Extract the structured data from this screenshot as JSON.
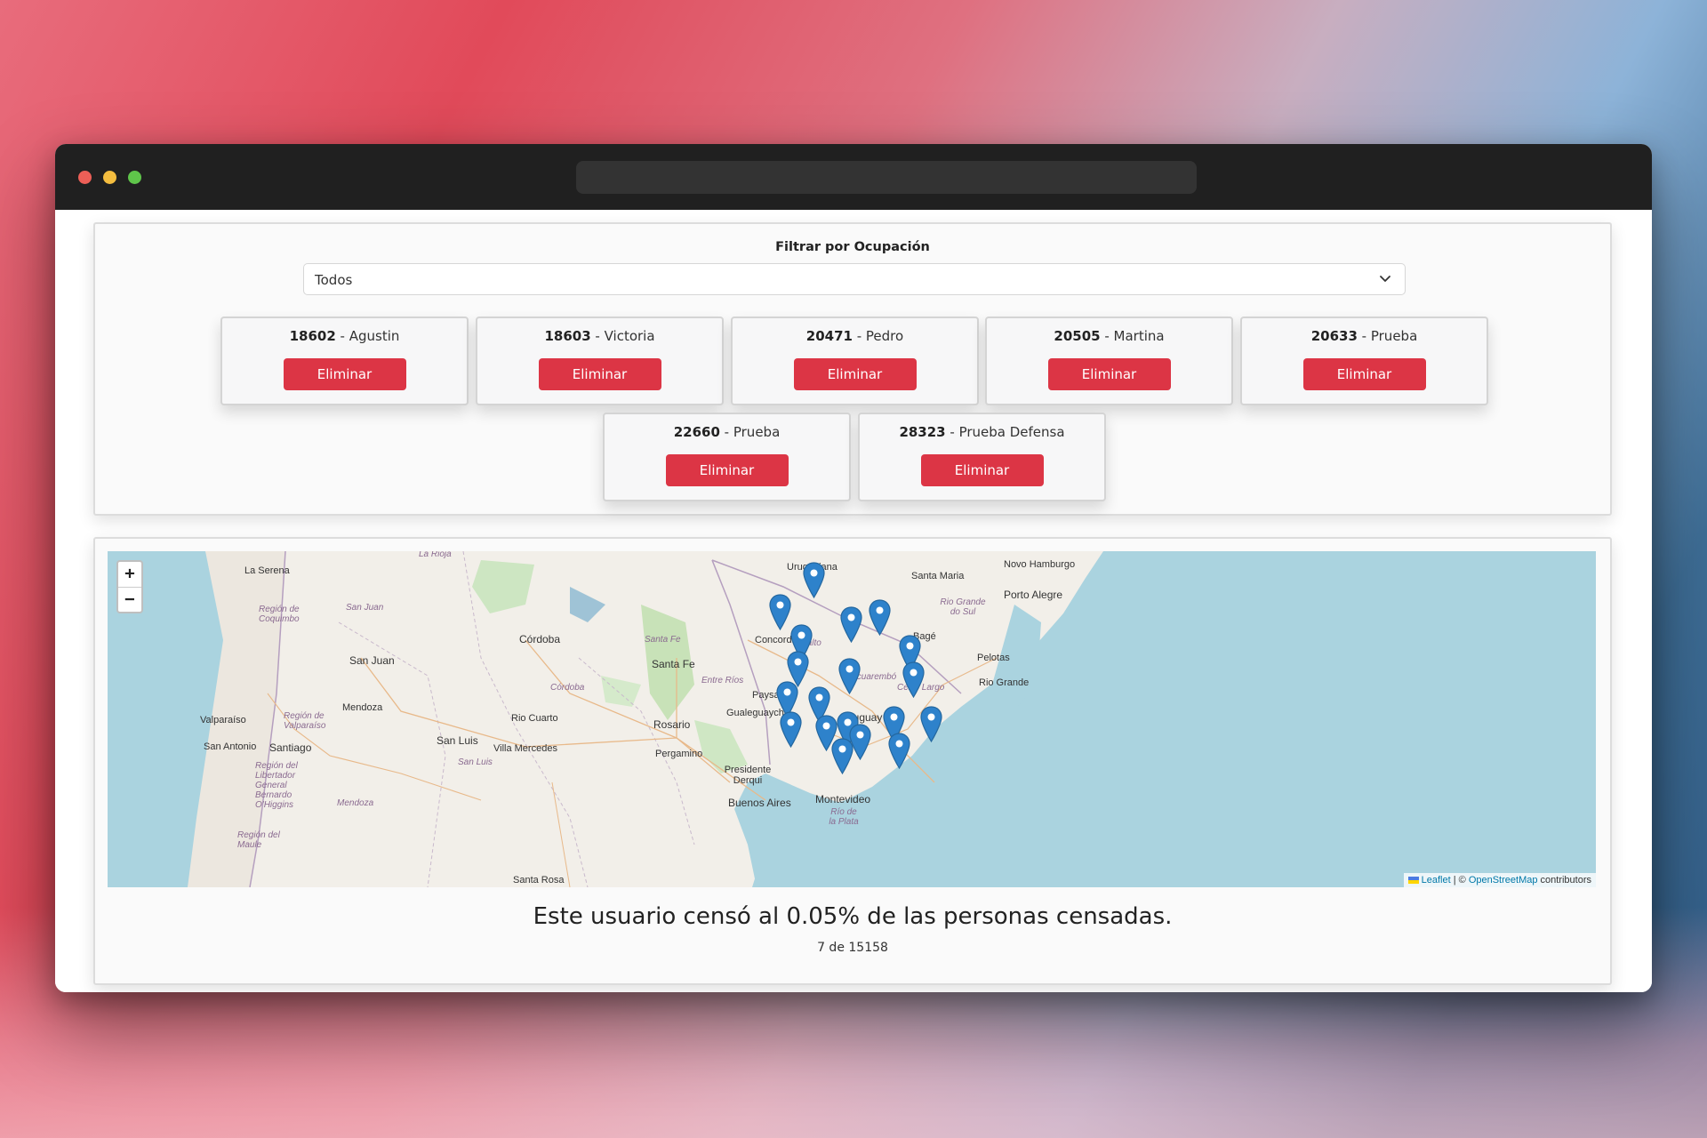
{
  "filter": {
    "label": "Filtrar por Ocupación",
    "selected": "Todos"
  },
  "cards": [
    {
      "id": "18602",
      "sep": " - ",
      "name": "Agustin",
      "button": "Eliminar"
    },
    {
      "id": "18603",
      "sep": " - ",
      "name": "Victoria",
      "button": "Eliminar"
    },
    {
      "id": "20471",
      "sep": " - ",
      "name": "Pedro",
      "button": "Eliminar"
    },
    {
      "id": "20505",
      "sep": " - ",
      "name": "Martina",
      "button": "Eliminar"
    },
    {
      "id": "20633",
      "sep": " - ",
      "name": "Prueba",
      "button": "Eliminar"
    },
    {
      "id": "22660",
      "sep": " - ",
      "name": "Prueba",
      "button": "Eliminar"
    },
    {
      "id": "28323",
      "sep": " - ",
      "name": "Prueba Defensa",
      "button": "Eliminar"
    }
  ],
  "map": {
    "zoom_in": "+",
    "zoom_out": "−",
    "attribution": {
      "leaflet": "Leaflet",
      "separator": " | © ",
      "osm": "OpenStreetMap",
      "suffix": " contributors"
    },
    "labels": [
      "La Serena",
      "La Rioja",
      "Uruguaiana",
      "Santa Maria",
      "Novo Hamburgo",
      "Porto Alegre",
      "Región de Coquimbo",
      "San Juan",
      "Córdoba",
      "Santa Fe",
      "Concordia",
      "Salto",
      "Rio Grande do Sul",
      "Bagé",
      "Pelotas",
      "San Juan",
      "Santa Fe",
      "Paysandú",
      "Entre Ríos",
      "Tacuarembó",
      "Rio Grande",
      "Cerro Largo",
      "Córdoba",
      "Mendoza",
      "Valparaíso",
      "Región de Valparaíso",
      "Rio Cuarto",
      "Gualeguaychú",
      "Uruguay",
      "Rosario",
      "San Antonio",
      "Santiago",
      "San Luis",
      "Villa Mercedes",
      "Pergamino",
      "San Luis",
      "Región del Libertador General Bernardo O'Higgins",
      "Presidente Derqui",
      "Buenos Aires",
      "Montevideo",
      "Mendoza",
      "Río de la Plata",
      "Región del Maule",
      "Santa Rosa"
    ]
  },
  "stats": {
    "message": "Este usuario censó al 0.05% de las personas censadas.",
    "count": "7 de 15158"
  }
}
